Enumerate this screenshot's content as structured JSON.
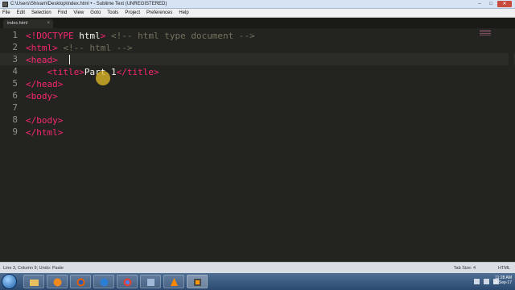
{
  "window": {
    "title": "C:\\Users\\Shivam\\Desktop\\index.html • - Sublime Text (UNREGISTERED)"
  },
  "menu": [
    "File",
    "Edit",
    "Selection",
    "Find",
    "View",
    "Goto",
    "Tools",
    "Project",
    "Preferences",
    "Help"
  ],
  "tab": {
    "name": "index.html"
  },
  "editor": {
    "line_numbers": [
      "1",
      "2",
      "3",
      "4",
      "5",
      "6",
      "7",
      "8",
      "9"
    ],
    "lines": [
      [
        {
          "t": "<!",
          "c": "tag"
        },
        {
          "t": "DOCTYPE",
          "c": "doctype"
        },
        {
          "t": " html",
          "c": "text"
        },
        {
          "t": ">",
          "c": "tag"
        },
        {
          "t": " <!-- html type document -->",
          "c": "comment"
        }
      ],
      [
        {
          "t": "<html>",
          "c": "tag"
        },
        {
          "t": " <!-- ",
          "c": "comment"
        },
        {
          "t": "html",
          "c": "comment"
        },
        {
          "t": " -->",
          "c": "comment"
        }
      ],
      [
        {
          "t": "<head>",
          "c": "tag"
        },
        {
          "t": "  ",
          "c": "text"
        }
      ],
      [
        {
          "t": "    <title>",
          "c": "tag"
        },
        {
          "t": "Part 1",
          "c": "text"
        },
        {
          "t": "</title>",
          "c": "tag"
        }
      ],
      [
        {
          "t": "</head>",
          "c": "tag"
        }
      ],
      [
        {
          "t": "<body>",
          "c": "tag"
        }
      ],
      [
        {
          "t": "",
          "c": "text"
        }
      ],
      [
        {
          "t": "</body>",
          "c": "tag"
        }
      ],
      [
        {
          "t": "</html>",
          "c": "tag"
        }
      ]
    ]
  },
  "status": {
    "left": "Line 3, Column 9; Undo: Paste",
    "tab_size": "Tab Size: 4",
    "syntax": "HTML"
  },
  "taskbar": {
    "apps": [
      "explorer",
      "media-player",
      "firefox",
      "ie",
      "chrome",
      "libraries",
      "vlc",
      "paint",
      "sublime-text"
    ],
    "clock_time": "11:28 AM",
    "clock_date": "18-Sep-17"
  },
  "colors": {
    "bg": "#23241f",
    "tag": "#f92672",
    "comment": "#75715e",
    "text": "#f8f8f2"
  }
}
